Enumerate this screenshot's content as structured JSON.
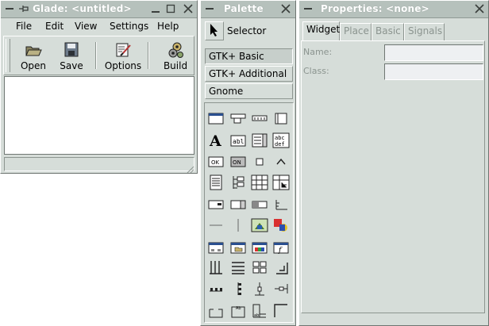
{
  "glade": {
    "title": "Glade: <untitled>",
    "menu": [
      "File",
      "Edit",
      "View",
      "Settings",
      "Help"
    ],
    "toolbar": {
      "open": "Open",
      "save": "Save",
      "options": "Options",
      "build": "Build"
    },
    "status": ""
  },
  "palette": {
    "title": "Palette",
    "selector_label": "Selector",
    "groups": [
      "GTK+ Basic",
      "GTK+ Additional",
      "Gnome"
    ],
    "active_group": "GTK+ Basic"
  },
  "properties": {
    "title": "Properties: <none>",
    "tabs": [
      "Widget",
      "Place",
      "Basic",
      "Signals"
    ],
    "active_tab": "Widget",
    "fields": [
      {
        "label": "Name:",
        "value": ""
      },
      {
        "label": "Class:",
        "value": ""
      }
    ]
  },
  "colors": {
    "window_bg": "#d6ddd9",
    "titlebar_bg": "#b6c1bc",
    "title_text": "#ffffff",
    "disabled_text": "#8b948f",
    "field_bg": "#eef0f2"
  }
}
